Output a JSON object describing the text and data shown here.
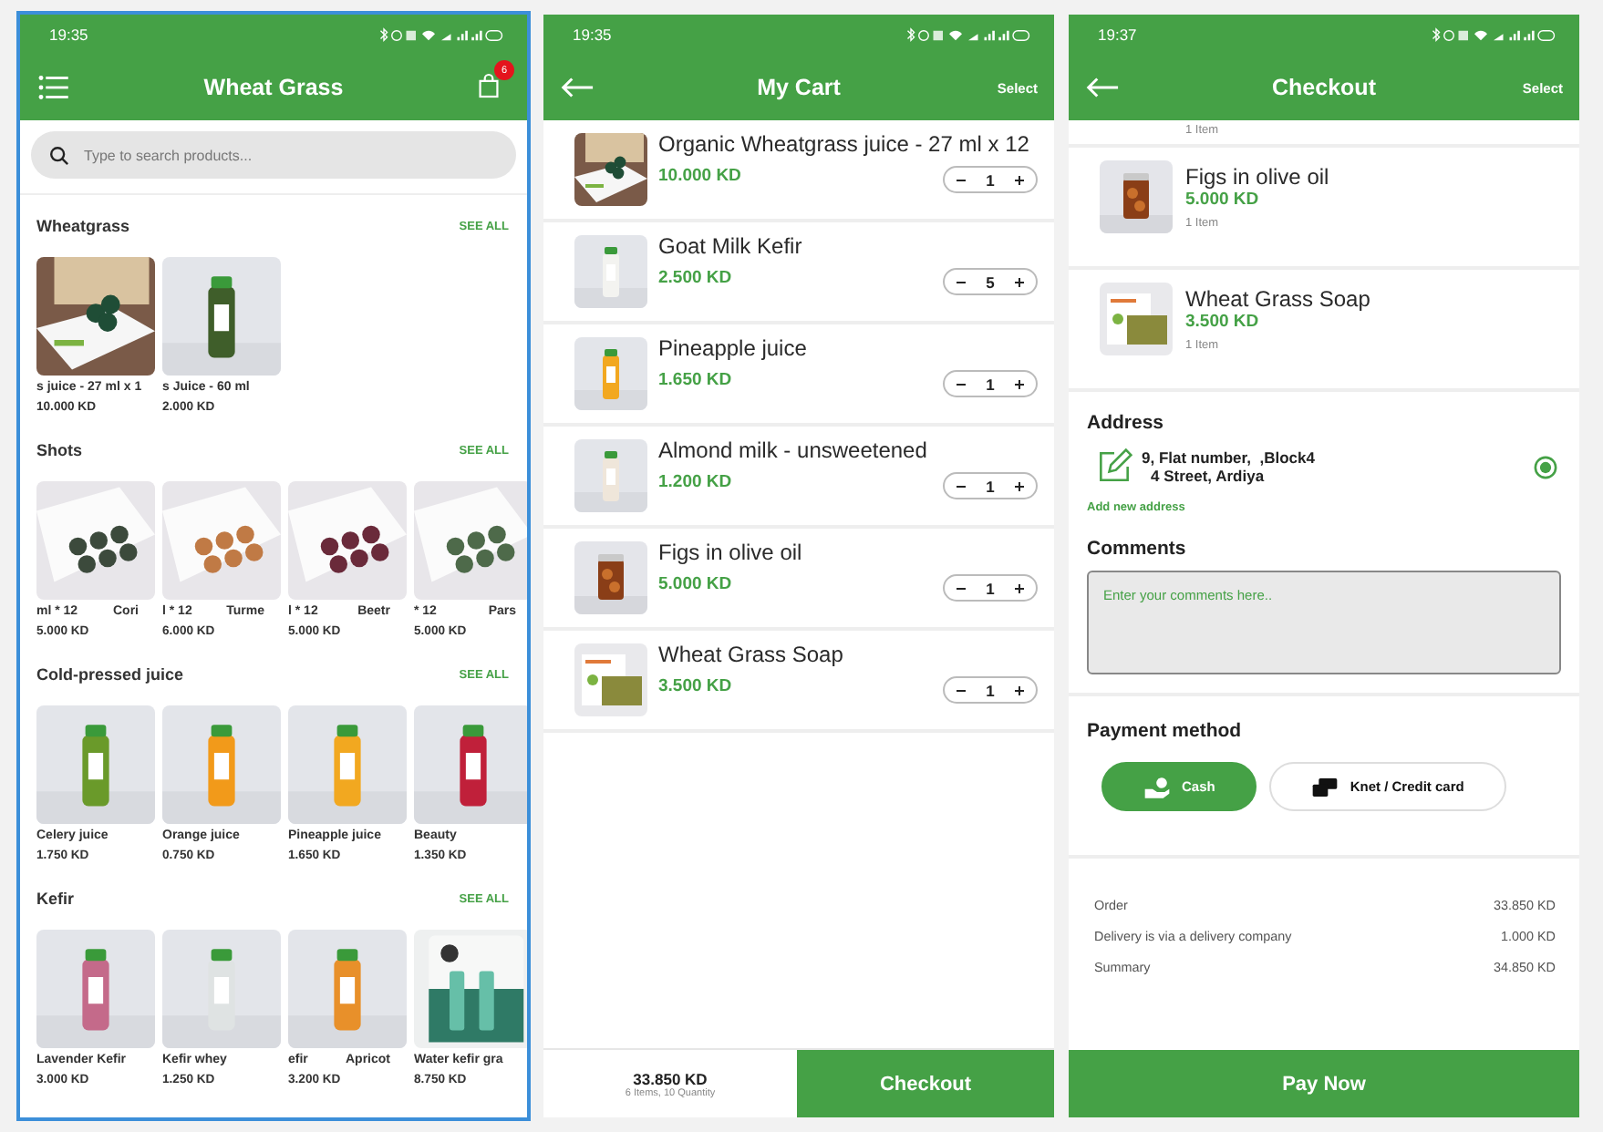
{
  "home": {
    "selected": true,
    "status_bar": {
      "time": "19:35"
    },
    "header": {
      "title": "Wheat Grass",
      "cart_badge": "6"
    },
    "search": {
      "placeholder": "Type to search products..."
    },
    "sections": [
      {
        "title": "Wheatgrass",
        "see_all": "SEE ALL",
        "products": [
          {
            "name": "s juice - 27 ml x 1",
            "price": "10.000 KD"
          },
          {
            "name": "s Juice - 60 ml",
            "price": "2.000 KD"
          }
        ]
      },
      {
        "title": "Shots",
        "see_all": "SEE ALL",
        "products": [
          {
            "name": "ml * 12",
            "name_tail": "Cori",
            "price": "5.000 KD"
          },
          {
            "name": "l * 12",
            "name_tail": "Turme",
            "price": "6.000 KD"
          },
          {
            "name": "l * 12",
            "name_tail": "Beetr",
            "price": "5.000 KD"
          },
          {
            "name": "* 12",
            "name_tail": "Pars",
            "price": "5.000 KD"
          }
        ]
      },
      {
        "title": "Cold-pressed juice",
        "see_all": "SEE ALL",
        "products": [
          {
            "name": "Celery juice",
            "price": "1.750 KD"
          },
          {
            "name": "Orange juice",
            "price": "0.750 KD"
          },
          {
            "name": "Pineapple juice",
            "price": "1.650 KD"
          },
          {
            "name": "Beauty",
            "price": "1.350 KD"
          }
        ]
      },
      {
        "title": "Kefir",
        "see_all": "SEE ALL",
        "products": [
          {
            "name": "Lavender Kefir",
            "price": "3.000 KD"
          },
          {
            "name": "Kefir whey",
            "price": "1.250 KD"
          },
          {
            "name": "efir",
            "name_tail": "Apricot",
            "price": "3.200 KD"
          },
          {
            "name": "Water kefir gra",
            "price": "8.750 KD"
          }
        ]
      }
    ]
  },
  "cart": {
    "selected": false,
    "status_bar": {
      "time": "19:35"
    },
    "header": {
      "title": "My Cart",
      "action": "Select"
    },
    "items": [
      {
        "name": "Organic Wheatgrass juice - 27 ml x 12",
        "price": "10.000 KD",
        "quantity": "1"
      },
      {
        "name": "Goat Milk Kefir",
        "price": "2.500 KD",
        "quantity": "5"
      },
      {
        "name": "Pineapple juice",
        "price": "1.650 KD",
        "quantity": "1"
      },
      {
        "name": "Almond milk - unsweetened",
        "price": "1.200 KD",
        "quantity": "1"
      },
      {
        "name": "Figs in olive oil",
        "price": "5.000 KD",
        "quantity": "1"
      },
      {
        "name": "Wheat Grass Soap",
        "price": "3.500 KD",
        "quantity": "1"
      }
    ],
    "footer": {
      "total": "33.850 KD",
      "summary": "6 Items, 10 Quantity",
      "button": "Checkout"
    }
  },
  "checkout": {
    "selected": false,
    "status_bar": {
      "time": "19:37"
    },
    "header": {
      "title": "Checkout",
      "action": "Select"
    },
    "hidden_count": "1 Item",
    "items": [
      {
        "name": "Figs in olive oil",
        "price": "5.000 KD",
        "count": "1 Item"
      },
      {
        "name": "Wheat Grass Soap",
        "price": "3.500 KD",
        "count": "1 Item"
      }
    ],
    "address": {
      "title": "Address",
      "lines": [
        "9, Flat number,  ,Block4",
        "4 Street, Ardiya"
      ],
      "selected": true,
      "add_link": "Add new address"
    },
    "comments": {
      "title": "Comments",
      "placeholder": "Enter your comments here.."
    },
    "payment": {
      "title": "Payment method",
      "options": [
        {
          "kind": "cash",
          "label": "Cash",
          "selected": true
        },
        {
          "kind": "card",
          "label": "Knet / Credit card",
          "selected": false
        }
      ]
    },
    "totals": [
      {
        "label": "Order",
        "value": "33.850 KD"
      },
      {
        "label": "Delivery is via a delivery company",
        "value": "1.000 KD"
      },
      {
        "label": "Summary",
        "value": "34.850 KD"
      }
    ],
    "pay_button": "Pay Now"
  }
}
